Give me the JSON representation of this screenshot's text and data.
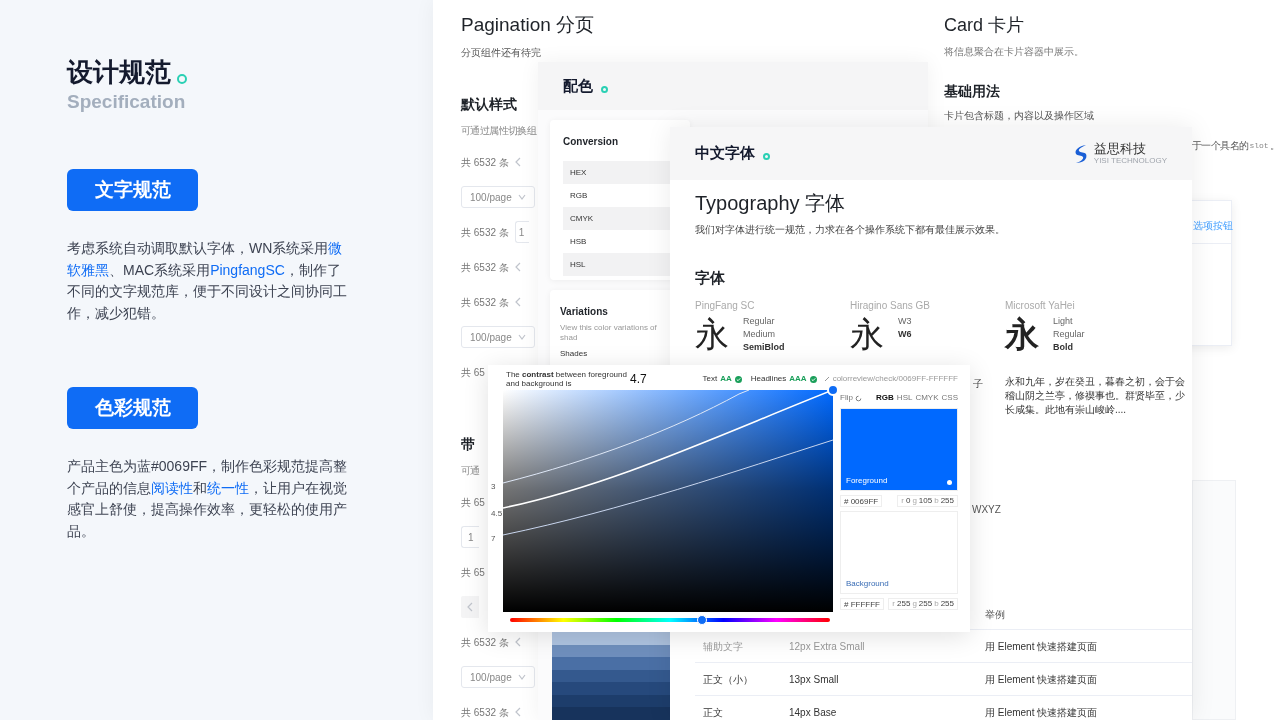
{
  "intro": {
    "title": "设计规范",
    "subtitle": "Specification"
  },
  "sections": [
    {
      "button": "文字规范",
      "paragraph": [
        {
          "text": "考虑系统自动调取默认字体，WN系统采用",
          "highlight": false
        },
        {
          "text": "微软雅黑",
          "highlight": true
        },
        {
          "text": "、MAC系统采用",
          "highlight": false
        },
        {
          "text": "PingfangSC",
          "highlight": true
        },
        {
          "text": "，制作了不同的文字规范库，便于不同设计之间协同工作，减少犯错。",
          "highlight": false
        }
      ]
    },
    {
      "button": "色彩规范",
      "paragraph": [
        {
          "text": "产品主色为蓝#0069FF，制作色彩规范提高整个产品的信息",
          "highlight": false
        },
        {
          "text": "阅读性",
          "highlight": true
        },
        {
          "text": "和",
          "highlight": false
        },
        {
          "text": "统一性",
          "highlight": true
        },
        {
          "text": "，让用户在视觉感官上舒使，提高操作效率，更轻松的使用产品。",
          "highlight": false
        }
      ]
    }
  ],
  "pagination": {
    "title": "Pagination 分页",
    "subtitle": "分页组件还有待完",
    "groups": [
      {
        "heading": "默认样式",
        "desc": "可通过属性切换组",
        "rows": [
          {
            "kind": "total",
            "text": "共 6532 条"
          },
          {
            "kind": "select",
            "text": "100/page"
          },
          {
            "kind": "input",
            "text": "共 6532 条",
            "value": "1"
          },
          {
            "kind": "total",
            "text": "共 6532 条"
          },
          {
            "kind": "total",
            "text": "共 6532 条"
          },
          {
            "kind": "select",
            "text": "100/page"
          },
          {
            "kind": "total",
            "text": "共 65"
          }
        ]
      },
      {
        "heading": "带",
        "desc": "可通",
        "rows": [
          {
            "kind": "total",
            "text": "共 65"
          },
          {
            "kind": "input",
            "value": "1"
          },
          {
            "kind": "total",
            "text": "共 65"
          },
          {
            "kind": "pager"
          },
          {
            "kind": "total",
            "text": "共 6532 条"
          },
          {
            "kind": "select",
            "text": "100/page"
          },
          {
            "kind": "total",
            "text": "共 6532 条"
          }
        ]
      }
    ]
  },
  "palette": {
    "title": "配色",
    "conversion": {
      "title": "Conversion",
      "rows": [
        "HEX",
        "RGB",
        "CMYK",
        "HSB",
        "HSL"
      ]
    },
    "variations": {
      "title": "Variations",
      "desc": "View this color variations of shad",
      "label": "Shades"
    }
  },
  "card": {
    "title": "Card 卡片",
    "desc": "将信息聚合在卡片容器中展示。",
    "heading": "基础用法",
    "text": "卡片包含标题，内容以及操作区域",
    "note_text": "于一个具名的",
    "note_code": "slot",
    "note_end": "。",
    "link": "选项按钮"
  },
  "typography": {
    "header": "中文字体",
    "brand": "益思科技",
    "brand_sub": "YISI TECHNOLOGY",
    "title": "Typography 字体",
    "desc": "我们对字体进行统一规范，力求在各个操作系统下都有最佳展示效果。",
    "heading": "字体",
    "fonts": [
      {
        "name": "PingFang SC",
        "glyph": "永",
        "weights": [
          "Regular",
          "Medium",
          "SemiBlod"
        ]
      },
      {
        "name": "Hiragino Sans GB",
        "glyph": "永",
        "weights": [
          "W3",
          "W6"
        ]
      },
      {
        "name": "Microsoft YaHei",
        "glyph": "永",
        "weights": [
          "Light",
          "Regular",
          "Bold"
        ]
      }
    ],
    "fragment": "子",
    "sample": "永和九年，岁在癸丑，暮春之初，会于会稽山阴之兰亭，修禊事也。群贤毕至，少长咸集。此地有崇山峻岭....",
    "alphabet": "WXYZ",
    "table": {
      "header": "举例",
      "rows": [
        [
          "辅助文字",
          "12px Extra Small",
          "用 Element 快速搭建页面"
        ],
        [
          "正文（小）",
          "13px Small",
          "用 Element 快速搭建页面"
        ],
        [
          "正文",
          "14px Base",
          "用 Element 快速搭建页面"
        ]
      ]
    }
  },
  "contrast": {
    "label": "The **contrast** between foreground and background is",
    "ratio": "4.7",
    "text_label": "Text",
    "text_grade": "AA",
    "headline_label": "Headlines",
    "headline_grade": "AAA",
    "link": "colorreview/check/0069FF-FFFFFF",
    "axis": [
      "3",
      "4.5",
      "7"
    ],
    "flip": "Flip",
    "modes": [
      {
        "label": "RGB",
        "selected": true
      },
      {
        "label": "HSL",
        "selected": false
      },
      {
        "label": "CMYK",
        "selected": false
      },
      {
        "label": "CSS",
        "selected": false
      }
    ],
    "foreground": {
      "label": "Foreground",
      "color": "#0069ff",
      "hex": "# 0069FF",
      "channels": [
        [
          "r",
          "0"
        ],
        [
          "g",
          "105"
        ],
        [
          "b",
          "255"
        ]
      ]
    },
    "background": {
      "label": "Background",
      "color": "#ffffff",
      "hex": "# FFFFFF",
      "channels": [
        [
          "r",
          "255"
        ],
        [
          "g",
          "255"
        ],
        [
          "b",
          "255"
        ]
      ]
    },
    "hue": {
      "level": 0.6
    }
  }
}
